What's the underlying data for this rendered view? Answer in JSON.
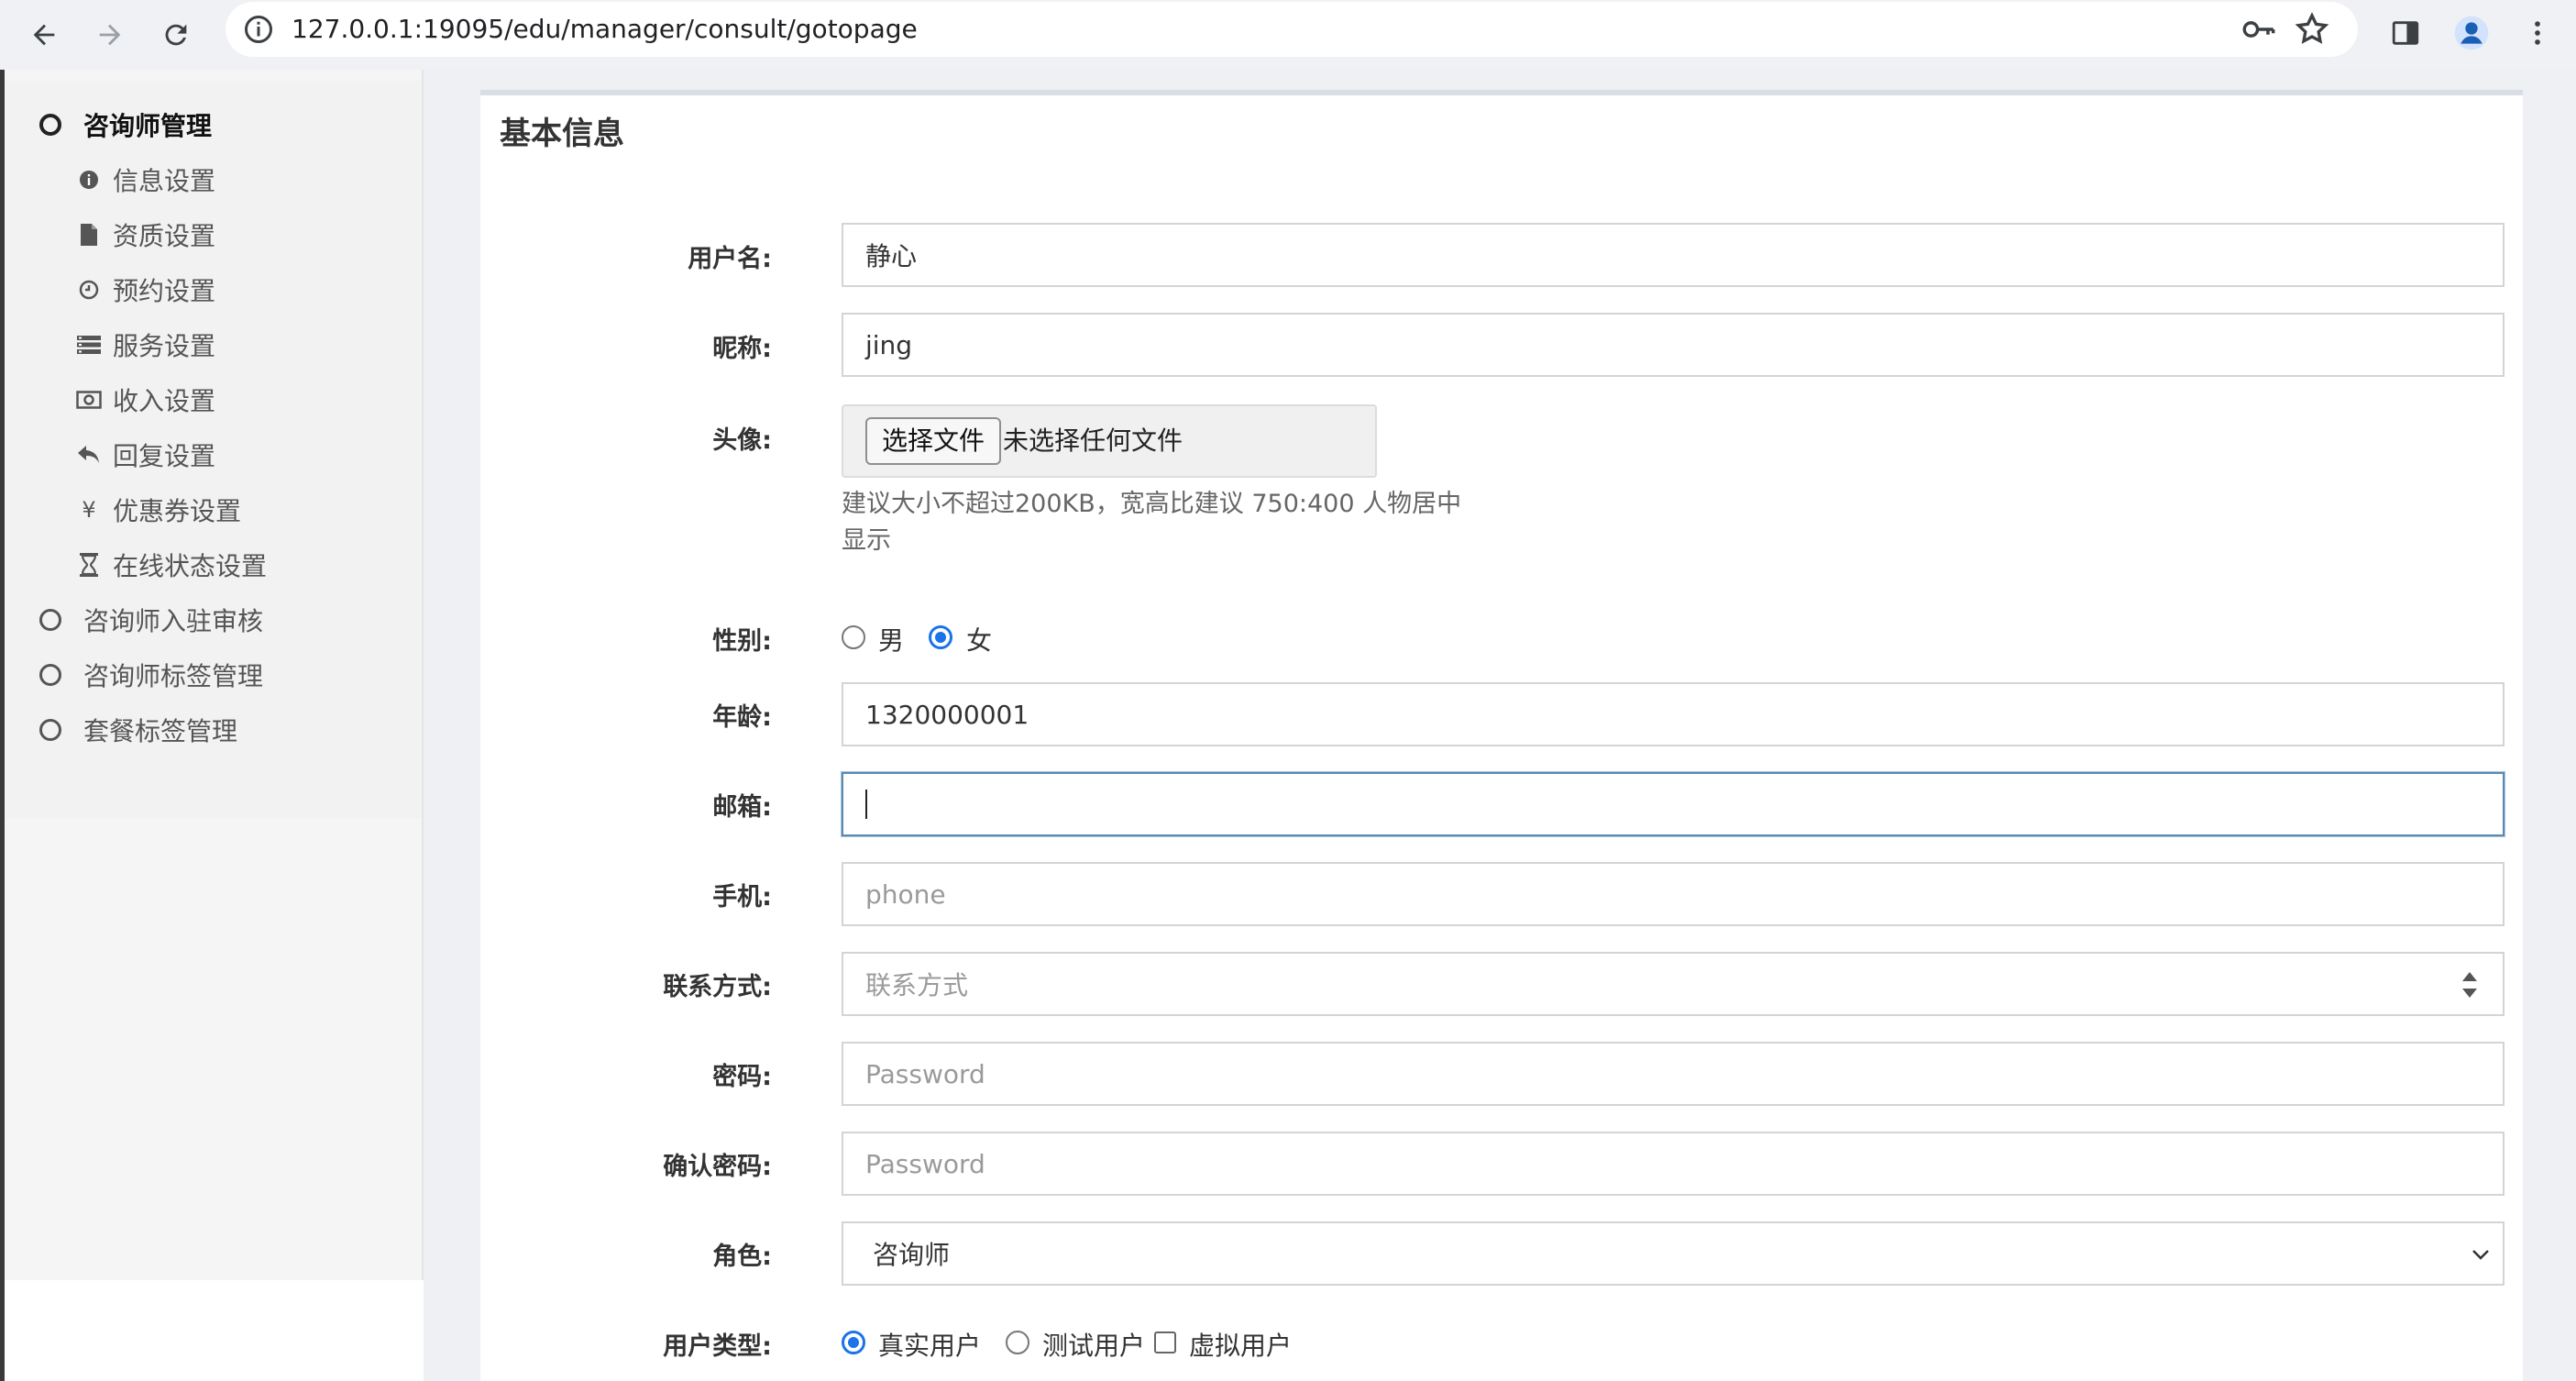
{
  "browser": {
    "url": "127.0.0.1:19095/edu/manager/consult/gotopage",
    "icons": [
      "back-arrow-icon",
      "forward-arrow-icon",
      "reload-icon",
      "site-info-icon",
      "key-icon",
      "star-icon",
      "side-panel-icon",
      "profile-icon",
      "more-icon"
    ]
  },
  "sidebar": {
    "sections": [
      {
        "label": "咨询师管理",
        "active": true
      },
      {
        "label": "咨询师入驻审核"
      },
      {
        "label": "咨询师标签管理"
      },
      {
        "label": "套餐标签管理"
      }
    ],
    "sub_items": [
      {
        "label": "信息设置",
        "icon": "info-icon"
      },
      {
        "label": "资质设置",
        "icon": "document-icon"
      },
      {
        "label": "预约设置",
        "icon": "clock-icon"
      },
      {
        "label": "服务设置",
        "icon": "list-icon"
      },
      {
        "label": "收入设置",
        "icon": "money-icon"
      },
      {
        "label": "回复设置",
        "icon": "reply-icon"
      },
      {
        "label": "优惠券设置",
        "icon": "yen-icon",
        "glyph": "¥"
      },
      {
        "label": "在线状态设置",
        "icon": "hourglass-icon"
      }
    ]
  },
  "panel": {
    "title": "基本信息"
  },
  "form": {
    "username": {
      "label": "用户名:",
      "value": "静心"
    },
    "nickname": {
      "label": "昵称:",
      "value": "jing"
    },
    "avatar": {
      "label": "头像:",
      "button": "选择文件",
      "status": "未选择任何文件",
      "hint_line1": "建议大小不超过200KB，宽高比建议 750:400 人物居中",
      "hint_line2": "显示"
    },
    "gender": {
      "label": "性别:",
      "options": [
        "男",
        "女"
      ],
      "selected": "女"
    },
    "age": {
      "label": "年龄:",
      "value": "1320000001"
    },
    "email": {
      "label": "邮箱:",
      "value": ""
    },
    "phone": {
      "label": "手机:",
      "placeholder": "phone"
    },
    "contact": {
      "label": "联系方式:",
      "placeholder": "联系方式"
    },
    "password": {
      "label": "密码:",
      "placeholder": "Password"
    },
    "confirm_password": {
      "label": "确认密码:",
      "placeholder": "Password"
    },
    "role": {
      "label": "角色:",
      "value": "咨询师"
    },
    "user_type": {
      "label": "用户类型:",
      "options": [
        "真实用户",
        "测试用户",
        "虚拟用户"
      ],
      "selected": "真实用户"
    }
  }
}
